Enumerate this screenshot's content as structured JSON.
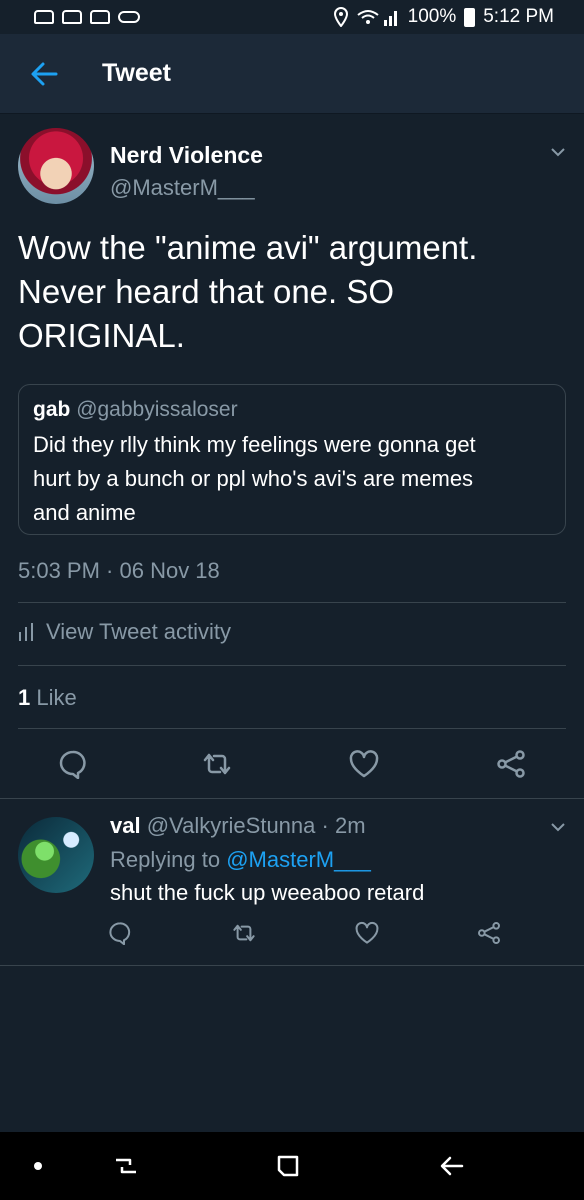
{
  "status_bar": {
    "battery": "100%",
    "time": "5:12 PM"
  },
  "header": {
    "title": "Tweet"
  },
  "tweet": {
    "author_name": "Nerd Violence",
    "author_handle": "@MasterM___",
    "text_lines": [
      "Wow the \"anime avi\" argument.",
      "Never heard that one. SO",
      "ORIGINAL."
    ],
    "quote": {
      "name": "gab",
      "handle": "@gabbyissaloser",
      "text_lines": [
        "Did they rlly think my feelings were gonna get",
        "hurt by a bunch or ppl who's avi's are memes",
        "and anime"
      ]
    },
    "timestamp": "5:03 PM · 06 Nov 18",
    "activity_label": "View Tweet activity",
    "like_count": "1",
    "like_label": "Like"
  },
  "reply": {
    "name": "val",
    "handle": "@ValkyrieStunna",
    "age": "· 2m",
    "replying_prefix": "Replying to",
    "replying_mention": "@MasterM___",
    "text": "shut the fuck up weeaboo retard"
  },
  "colors": {
    "background": "#15202b",
    "header": "#1c2938",
    "accent": "#1da1f2",
    "muted": "#8899a6",
    "border": "#38444d"
  },
  "icons": [
    "back-arrow-icon",
    "chevron-down-icon",
    "bar-chart-icon",
    "reply-icon",
    "retweet-icon",
    "like-icon",
    "share-icon",
    "recent-apps-icon",
    "home-icon",
    "back-nav-icon"
  ]
}
